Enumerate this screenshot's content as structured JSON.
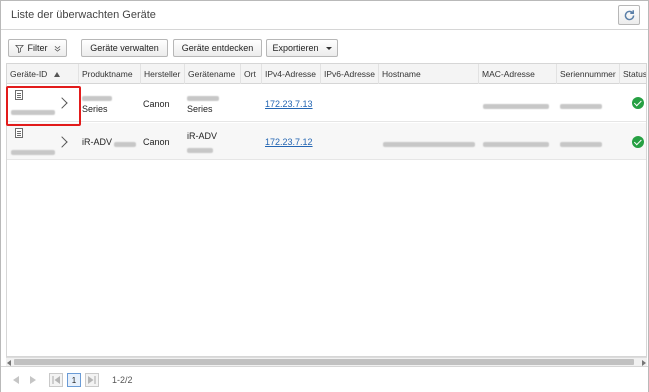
{
  "window": {
    "title": "Liste der überwachten Geräte",
    "refresh_icon": "refresh-icon"
  },
  "toolbar": {
    "filter_label": "Filter",
    "manage_label": "Geräte verwalten",
    "discover_label": "Geräte entdecken",
    "export_label": "Exportieren"
  },
  "table": {
    "columns": [
      "Geräte-ID",
      "Produktname",
      "Hersteller",
      "Gerätename",
      "Ort",
      "IPv4-Adresse",
      "IPv6-Adresse",
      "Hostname",
      "MAC-Adresse",
      "Seriennummer",
      "Status"
    ],
    "sorted_column": "Geräte-ID",
    "sort_direction": "ascending",
    "rows": [
      {
        "product_name": "Series",
        "manufacturer": "Canon",
        "device_name": "Series",
        "ipv4": "172.23.7.13",
        "status": "ok"
      },
      {
        "product_name": "iR-ADV",
        "manufacturer": "Canon",
        "device_name": "iR-ADV",
        "ipv4": "172.23.7.12",
        "status": "ok"
      }
    ]
  },
  "pager": {
    "current_page": "1",
    "range": "1-2/2"
  },
  "colors": {
    "highlight": "#e21b1b",
    "status_ok": "#26a043",
    "link": "#2466b3"
  }
}
